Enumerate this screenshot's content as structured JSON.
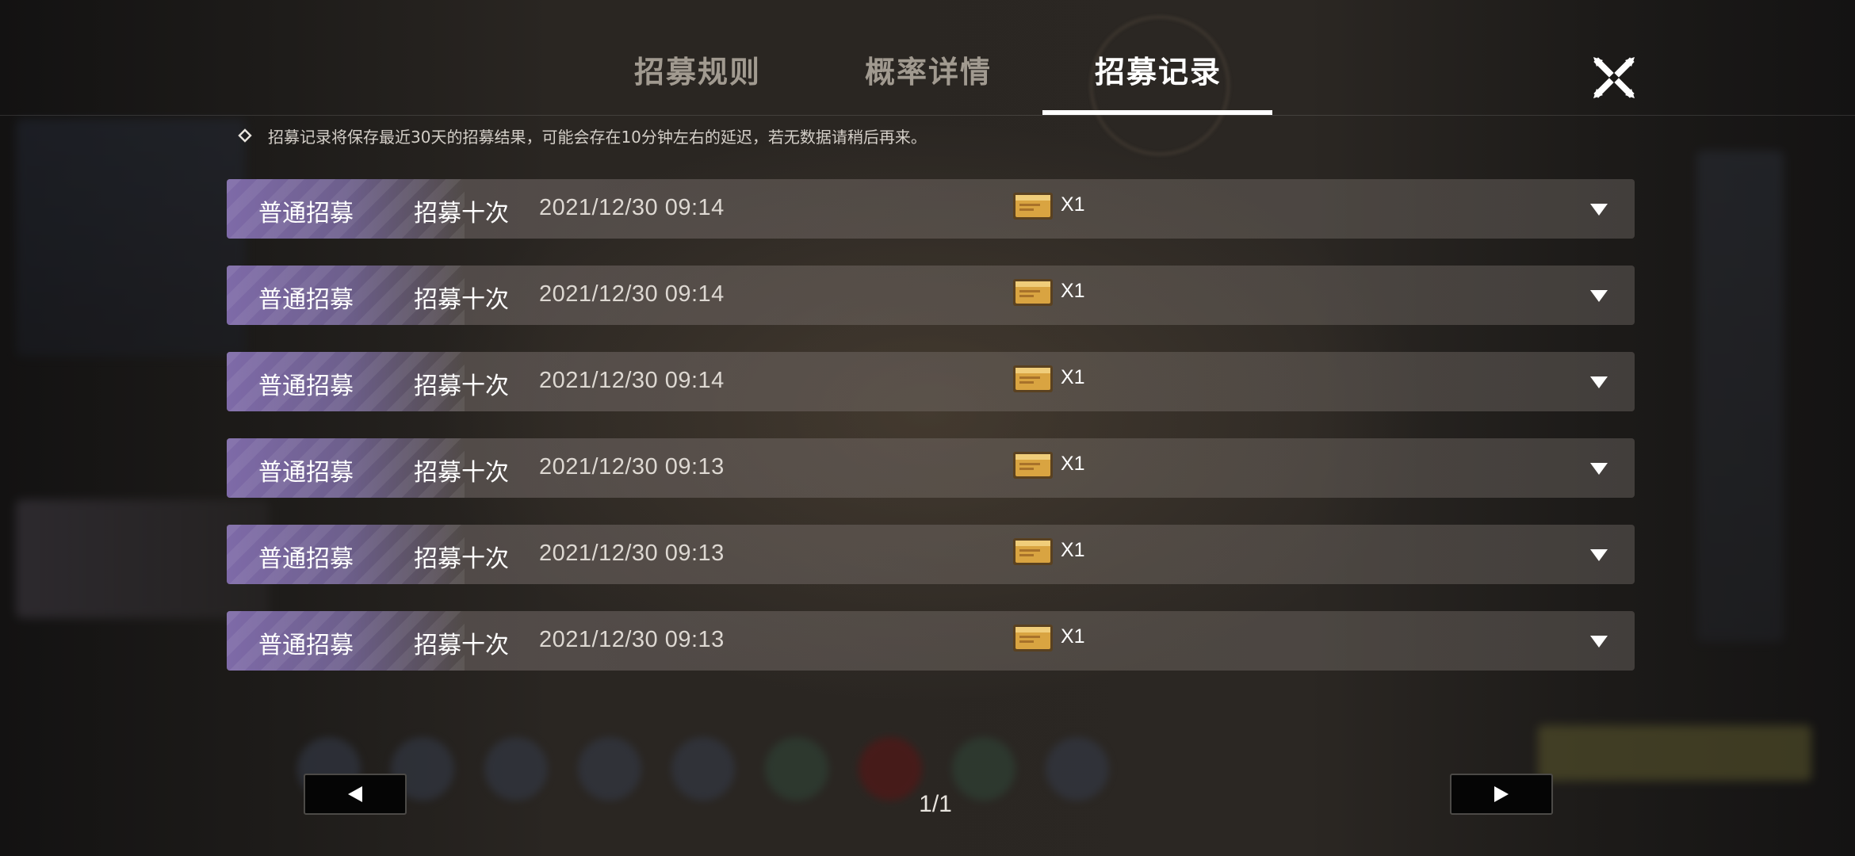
{
  "tabs": [
    {
      "label": "招募规则",
      "active": false
    },
    {
      "label": "概率详情",
      "active": false
    },
    {
      "label": "招募记录",
      "active": true
    }
  ],
  "notice": {
    "icon": "diamond-outline-icon",
    "text": "招募记录将保存最近30天的招募结果，可能会存在10分钟左右的延迟，若无数据请稍后再来。"
  },
  "records": [
    {
      "type": "普通招募",
      "count": "招募十次",
      "time": "2021/12/30 09:14",
      "cost_icon": "recruit-ticket-icon",
      "cost_qty": "X1"
    },
    {
      "type": "普通招募",
      "count": "招募十次",
      "time": "2021/12/30 09:14",
      "cost_icon": "recruit-ticket-icon",
      "cost_qty": "X1"
    },
    {
      "type": "普通招募",
      "count": "招募十次",
      "time": "2021/12/30 09:14",
      "cost_icon": "recruit-ticket-icon",
      "cost_qty": "X1"
    },
    {
      "type": "普通招募",
      "count": "招募十次",
      "time": "2021/12/30 09:13",
      "cost_icon": "recruit-ticket-icon",
      "cost_qty": "X1"
    },
    {
      "type": "普通招募",
      "count": "招募十次",
      "time": "2021/12/30 09:13",
      "cost_icon": "recruit-ticket-icon",
      "cost_qty": "X1"
    },
    {
      "type": "普通招募",
      "count": "招募十次",
      "time": "2021/12/30 09:13",
      "cost_icon": "recruit-ticket-icon",
      "cost_qty": "X1"
    }
  ],
  "pagination": {
    "label": "1/1",
    "prev_icon": "triangle-left-icon",
    "next_icon": "triangle-right-icon"
  },
  "colors": {
    "accent_purple": "#7e6aa8",
    "tab_active": "#ffffff",
    "tab_inactive": "#a19a90",
    "ticket_gold": "#d9a441"
  }
}
